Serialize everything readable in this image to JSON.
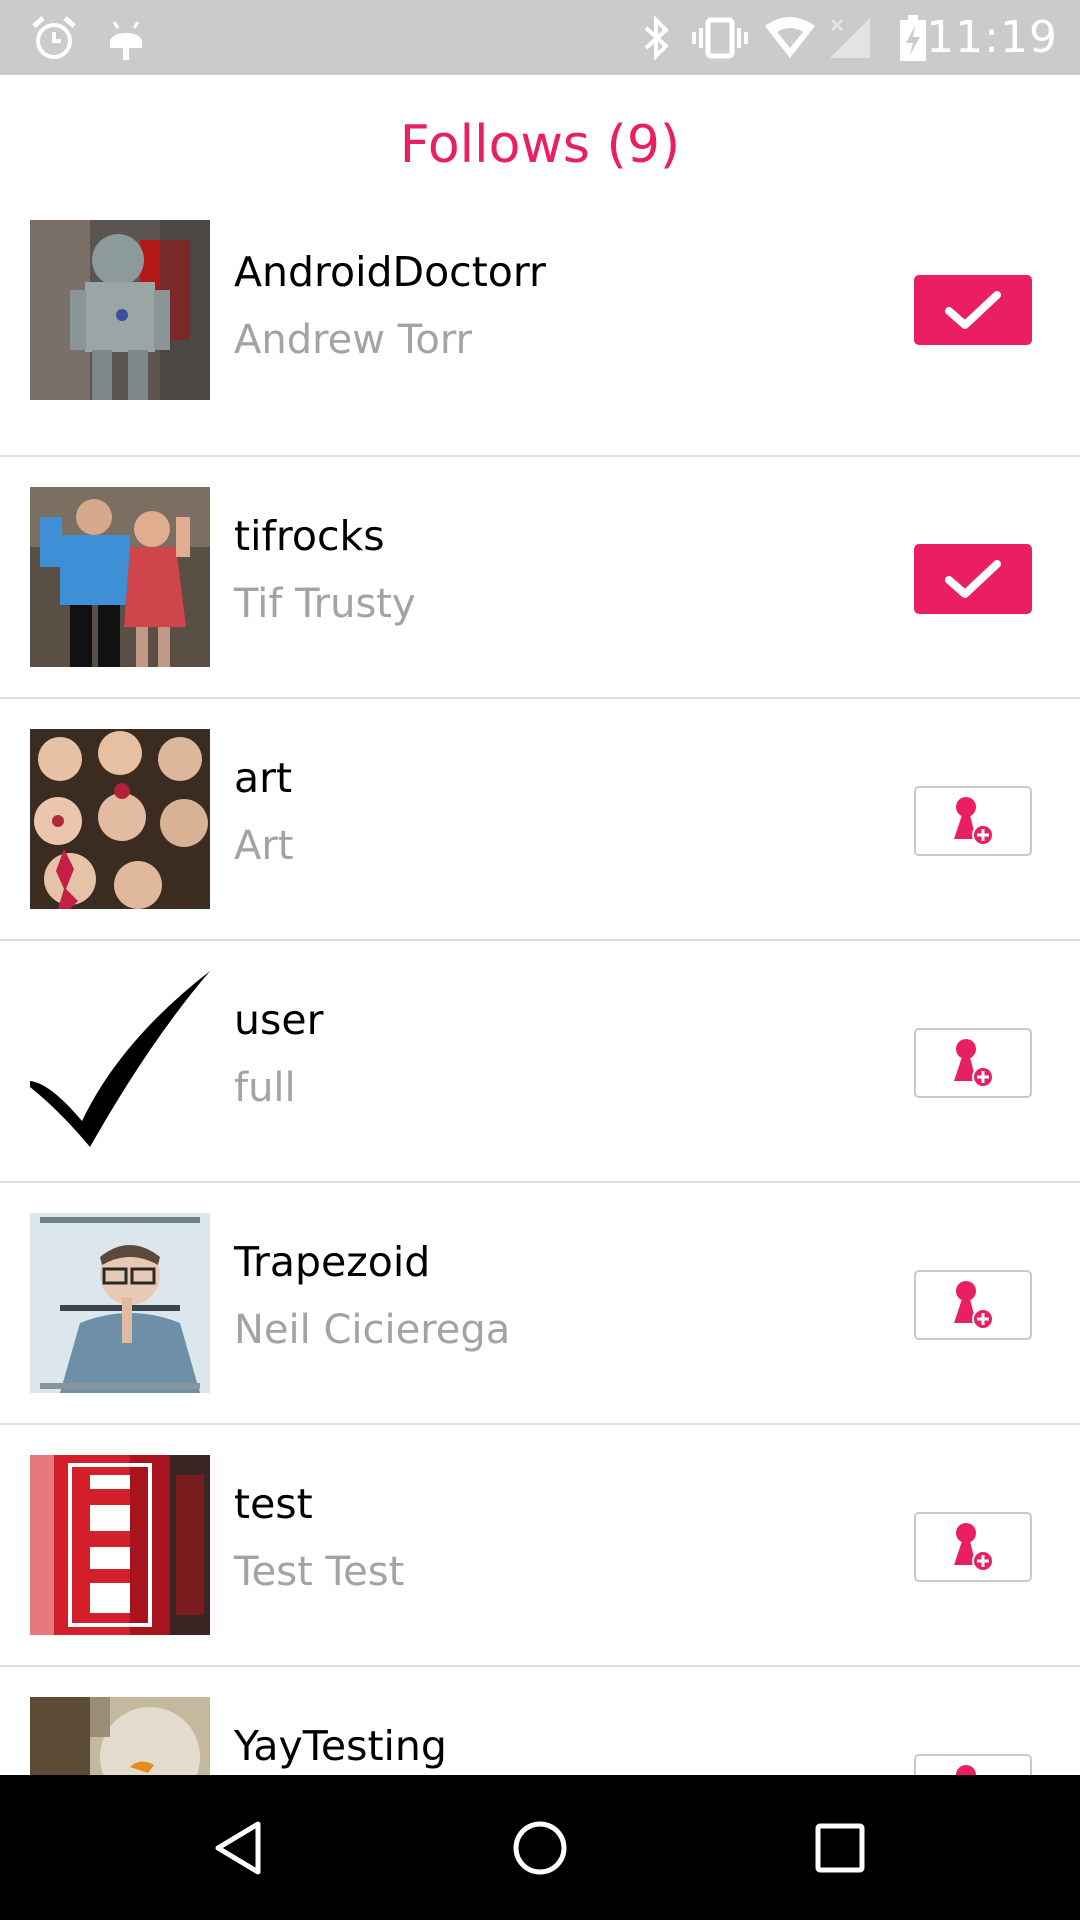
{
  "status_bar": {
    "time": "11:19",
    "left_icons": [
      "alarm-icon",
      "android-debug-icon"
    ],
    "right_icons": [
      "bluetooth-icon",
      "vibrate-icon",
      "wifi-icon",
      "signal-off-icon",
      "battery-charging-icon"
    ]
  },
  "header": {
    "title": "Follows (9)"
  },
  "follows": [
    {
      "username": "AndroidDoctorr",
      "full_name": "Andrew Torr",
      "following": true,
      "avatar": "robot-photo"
    },
    {
      "username": "tifrocks",
      "full_name": "Tif Trusty",
      "following": true,
      "avatar": "couple-photo"
    },
    {
      "username": "art",
      "full_name": "Art",
      "following": false,
      "avatar": "cookies-photo"
    },
    {
      "username": "user",
      "full_name": "full",
      "following": false,
      "avatar": "checkmark-image"
    },
    {
      "username": "Trapezoid",
      "full_name": "Neil Cicierega",
      "following": false,
      "avatar": "album-cover-photo"
    },
    {
      "username": "test",
      "full_name": "Test Test",
      "following": false,
      "avatar": "red-can-photo"
    },
    {
      "username": "YayTesting",
      "full_name": "",
      "following": false,
      "avatar": "fishbowl-photo"
    }
  ],
  "nav_bar": {
    "buttons": [
      "back-icon",
      "home-icon",
      "recents-icon"
    ]
  },
  "colors": {
    "accent": "#e91e63",
    "status_bar_bg": "#cbcbcb",
    "secondary_text": "#a3a3a3",
    "divider": "#dddddd"
  }
}
